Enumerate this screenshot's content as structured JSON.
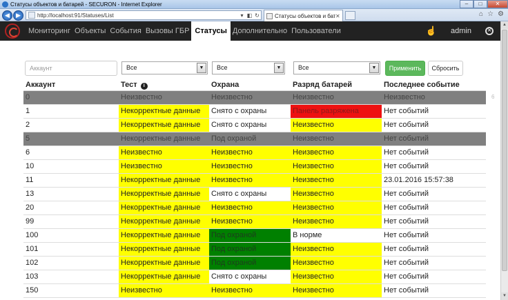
{
  "window": {
    "title": "Статусы объектов и батарей - SECURON - Internet Explorer",
    "minimize": "–",
    "maximize": "□",
    "close": "✕"
  },
  "browser": {
    "url": "http://localhost:91/Statuses/List",
    "tab_title": "Статусы объектов и батар...",
    "tools": [
      "⌂",
      "☆",
      "⚙"
    ]
  },
  "nav": {
    "items": [
      "Мониторинг",
      "Объекты",
      "События",
      "Вызовы ГБР",
      "Статусы",
      "Дополнительно",
      "Пользователи"
    ],
    "active_index": 4,
    "user": "admin"
  },
  "filters": {
    "account_placeholder": "Аккаунт",
    "test_value": "Все",
    "guard_value": "Все",
    "battery_value": "Все",
    "apply_label": "Применить",
    "reset_label": "Сбросить"
  },
  "table": {
    "headers": [
      "Аккаунт",
      "Тест",
      "Охрана",
      "Разряд батарей",
      "Последнее событие"
    ],
    "rows": [
      {
        "account": "0",
        "test": "Неизвестно",
        "guard": "Неизвестно",
        "battery": "Неизвестно",
        "last": "Неизвестно",
        "row_color": "grey",
        "colors": [
          "",
          "",
          "",
          "",
          ""
        ]
      },
      {
        "account": "1",
        "test": "Некорректные данные",
        "guard": "Снято с охраны",
        "battery": "Панель разряжена",
        "last": "Нет событий",
        "row_color": "",
        "colors": [
          "",
          "yellow",
          "white",
          "red",
          ""
        ]
      },
      {
        "account": "2",
        "test": "Некорректные данные",
        "guard": "Снято с охраны",
        "battery": "Неизвестно",
        "last": "Нет событий",
        "row_color": "",
        "colors": [
          "",
          "yellow",
          "white",
          "yellow",
          ""
        ]
      },
      {
        "account": "5",
        "test": "Некорректные данные",
        "guard": "Под охраной",
        "battery": "Неизвестно",
        "last": "Нет событий",
        "row_color": "grey",
        "colors": [
          "",
          "",
          "",
          "",
          ""
        ]
      },
      {
        "account": "6",
        "test": "Неизвестно",
        "guard": "Неизвестно",
        "battery": "Неизвестно",
        "last": "Нет событий",
        "row_color": "",
        "colors": [
          "",
          "yellow",
          "yellow",
          "yellow",
          ""
        ]
      },
      {
        "account": "10",
        "test": "Неизвестно",
        "guard": "Неизвестно",
        "battery": "Неизвестно",
        "last": "Нет событий",
        "row_color": "",
        "colors": [
          "",
          "yellow",
          "yellow",
          "yellow",
          ""
        ]
      },
      {
        "account": "11",
        "test": "Некорректные данные",
        "guard": "Неизвестно",
        "battery": "Неизвестно",
        "last": "23.01.2016 15:57:38",
        "row_color": "",
        "colors": [
          "",
          "yellow",
          "yellow",
          "yellow",
          ""
        ]
      },
      {
        "account": "13",
        "test": "Некорректные данные",
        "guard": "Снято с охраны",
        "battery": "Неизвестно",
        "last": "Нет событий",
        "row_color": "",
        "colors": [
          "",
          "yellow",
          "white",
          "yellow",
          ""
        ]
      },
      {
        "account": "20",
        "test": "Некорректные данные",
        "guard": "Неизвестно",
        "battery": "Неизвестно",
        "last": "Нет событий",
        "row_color": "",
        "colors": [
          "",
          "yellow",
          "yellow",
          "yellow",
          ""
        ]
      },
      {
        "account": "99",
        "test": "Некорректные данные",
        "guard": "Неизвестно",
        "battery": "Неизвестно",
        "last": "Нет событий",
        "row_color": "",
        "colors": [
          "",
          "yellow",
          "yellow",
          "yellow",
          ""
        ]
      },
      {
        "account": "100",
        "test": "Некорректные данные",
        "guard": "Под охраной",
        "battery": "В норме",
        "last": "Нет событий",
        "row_color": "",
        "colors": [
          "",
          "yellow",
          "green",
          "white",
          ""
        ]
      },
      {
        "account": "101",
        "test": "Некорректные данные",
        "guard": "Под охраной",
        "battery": "Неизвестно",
        "last": "Нет событий",
        "row_color": "",
        "colors": [
          "",
          "yellow",
          "green",
          "yellow",
          ""
        ]
      },
      {
        "account": "102",
        "test": "Некорректные данные",
        "guard": "Под охраной",
        "battery": "Неизвестно",
        "last": "Нет событий",
        "row_color": "",
        "colors": [
          "",
          "yellow",
          "green",
          "yellow",
          ""
        ]
      },
      {
        "account": "103",
        "test": "Некорректные данные",
        "guard": "Снято с охраны",
        "battery": "Неизвестно",
        "last": "Нет событий",
        "row_color": "",
        "colors": [
          "",
          "yellow",
          "white",
          "yellow",
          ""
        ]
      },
      {
        "account": "150",
        "test": "Неизвестно",
        "guard": "Неизвестно",
        "battery": "Неизвестно",
        "last": "Нет событий",
        "row_color": "",
        "colors": [
          "",
          "yellow",
          "yellow",
          "yellow",
          ""
        ]
      }
    ]
  },
  "side_number": "6",
  "colors": {
    "yellow": "#ffff00",
    "red": "#ee1111",
    "green": "#008000",
    "grey": "#808080",
    "navbar": "#222222",
    "apply": "#5cb85c"
  }
}
